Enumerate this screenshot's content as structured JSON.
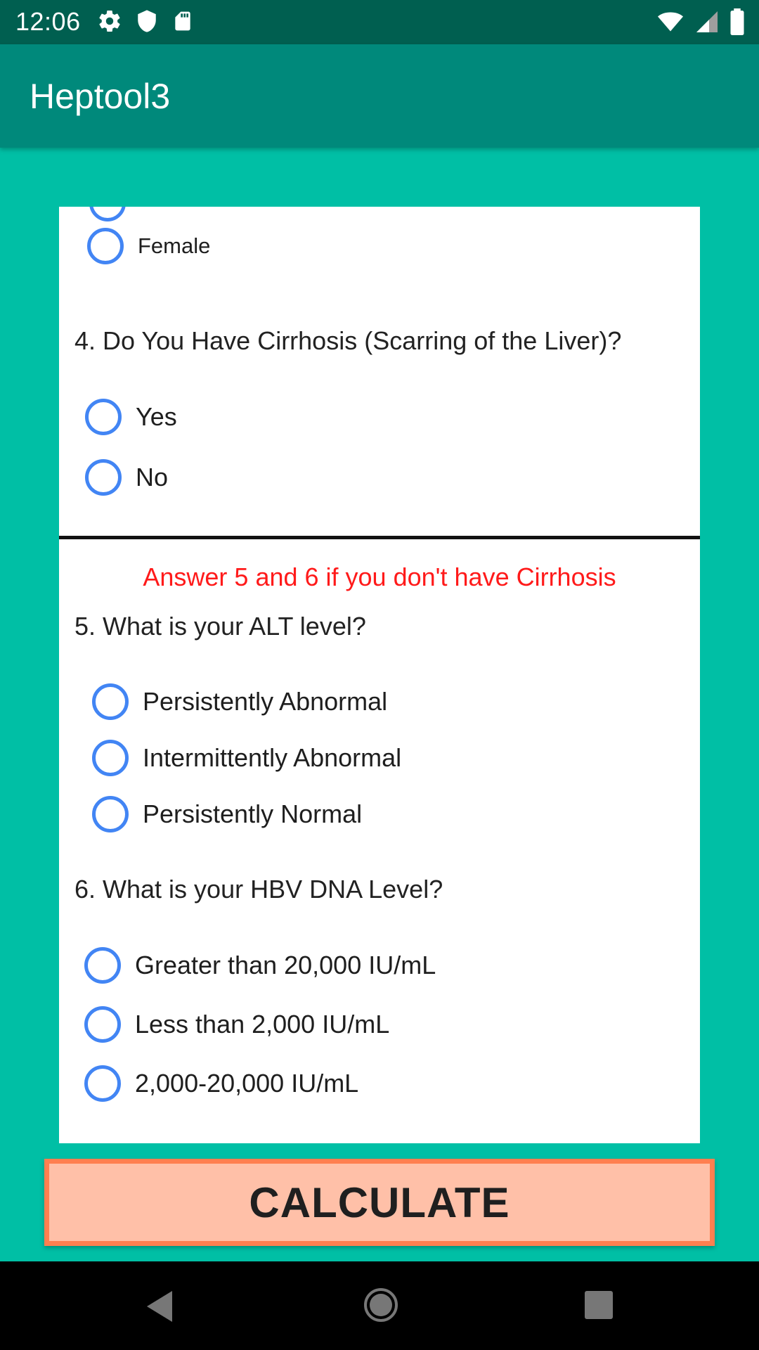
{
  "status_bar": {
    "time": "12:06",
    "left_icons": [
      "gear-icon",
      "shield-icon",
      "sd-card-icon"
    ],
    "right_icons": [
      "wifi-icon",
      "cellular-signal-icon",
      "battery-icon"
    ]
  },
  "app_bar": {
    "title": "Heptool3"
  },
  "form": {
    "q3_options": [
      {
        "label": "Female",
        "selected": false
      }
    ],
    "q4": {
      "question": "4. Do You Have Cirrhosis (Scarring of the Liver)?",
      "options": [
        {
          "label": "Yes",
          "selected": false
        },
        {
          "label": "No",
          "selected": false
        }
      ]
    },
    "notice": "Answer 5 and 6 if you don't have Cirrhosis",
    "q5": {
      "question": "5. What is your ALT level?",
      "options": [
        {
          "label": "Persistently Abnormal",
          "selected": false
        },
        {
          "label": "Intermittently Abnormal",
          "selected": false
        },
        {
          "label": "Persistently Normal",
          "selected": false
        }
      ]
    },
    "q6": {
      "question": "6. What is your HBV DNA Level?",
      "options": [
        {
          "label": "Greater than 20,000 IU/mL",
          "selected": false
        },
        {
          "label": "Less than 2,000 IU/mL",
          "selected": false
        },
        {
          "label": "2,000-20,000 IU/mL",
          "selected": false
        }
      ]
    }
  },
  "calculate_button": {
    "label": "CALCULATE"
  },
  "colors": {
    "status_bar": "#005f50",
    "app_bar": "#00897b",
    "background": "#00bfa5",
    "radio": "#4285f4",
    "notice": "#ff1a1a",
    "button_fill": "#ffc0a8",
    "button_border": "#ff7f50"
  },
  "nav_bar": {
    "icons": [
      "back-icon",
      "home-icon",
      "recents-icon"
    ]
  }
}
